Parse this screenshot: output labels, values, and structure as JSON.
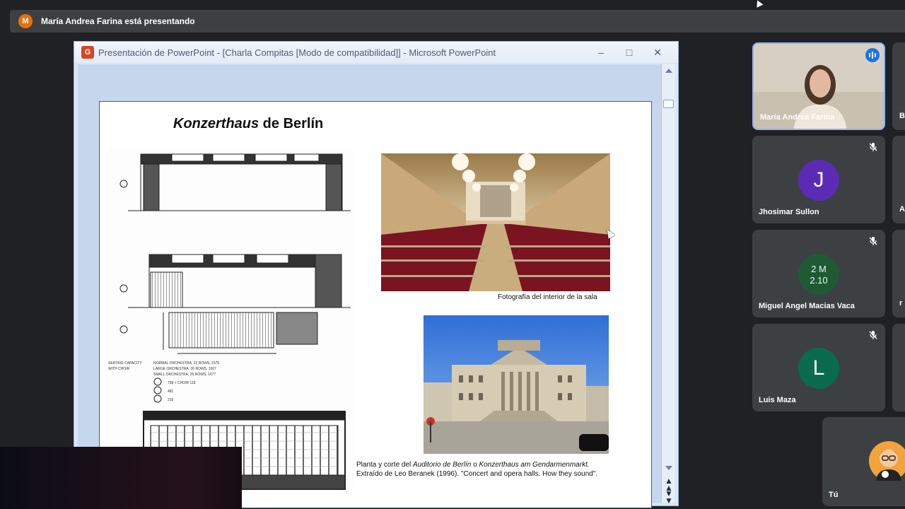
{
  "meet": {
    "presenter_banner": {
      "avatar_letter": "M",
      "text": "María Andrea Farina está presentando"
    },
    "participants": [
      {
        "name": "María Andrea Farina",
        "speaking": true
      },
      {
        "name": "Jhosimar Sullon",
        "initial": "J",
        "avatar_color": "#5b2bb5",
        "muted": true
      },
      {
        "name": "Miguel Angel Macias Vaca",
        "muted": true
      },
      {
        "name": "Luis Maza",
        "initial": "L",
        "avatar_color": "#0b6b4f",
        "muted": true
      }
    ],
    "edge_letters": [
      "B",
      "A",
      "r"
    ],
    "self_label": "Tú"
  },
  "powerpoint": {
    "window_title": "Presentación de PowerPoint - [Charla Compitas [Modo de compatibilidad]] - Microsoft PowerPoint",
    "slide": {
      "title_italic": "Konzerthaus",
      "title_rest": " de Berlín",
      "photo_caption": "Fotografía del interior de la sala",
      "caption_prefix": "Planta y corte del ",
      "caption_italic_1": "Auditorio de Berlín",
      "caption_mid": " o ",
      "caption_italic_2": "Konzerthaus am Gendarmenmarkt.",
      "caption_line2": "Extraído de Leo Beranek (1996). \"Concert and opera halls. How they sound\".",
      "capacity_label": "SEATING CAPACITY WITH CHOIR",
      "capacity_rows": [
        "NORMAL ORCHESTRA, 22 ROWS, 1575",
        "LARGE ORCHESTRA, 26 ROWS, 1507",
        "SMALL ORCHESTRA, 25 ROWS, 1677"
      ],
      "capacity_values": [
        "768 + CHOIR 118",
        "481",
        "210"
      ]
    }
  }
}
